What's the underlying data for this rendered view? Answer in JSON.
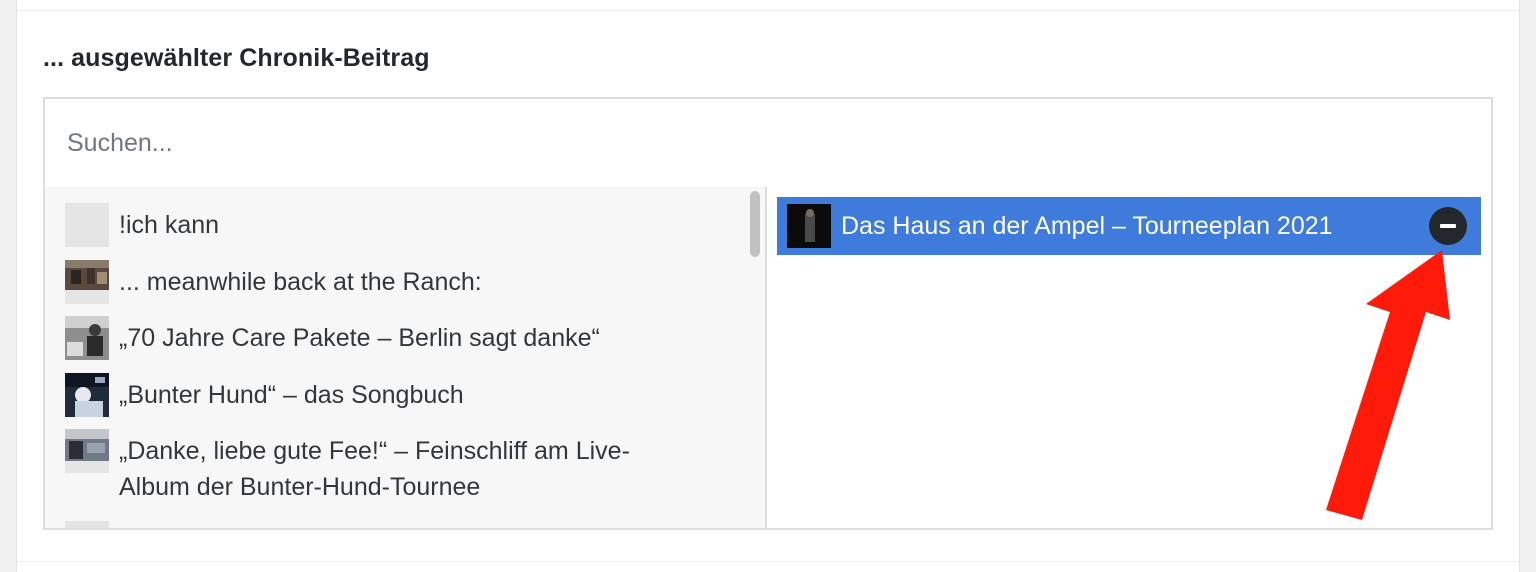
{
  "field": {
    "label": "... ausgewählter Chronik-Beitrag",
    "search_placeholder": "Suchen..."
  },
  "choices": [
    {
      "label": "!ich kann",
      "thumb": "blank"
    },
    {
      "label": "... meanwhile back at the Ranch:",
      "thumb": "photo"
    },
    {
      "label": "„70 Jahre Care Pakete – Berlin sagt danke“",
      "thumb": "photo"
    },
    {
      "label": "„Bunter Hund“ – das Songbuch",
      "thumb": "photo"
    },
    {
      "label": "„Danke, liebe gute Fee!“ – Feinschliff am Live-",
      "thumb": "photo"
    },
    {
      "label": "Album der Bunter-Hund-Tournee",
      "thumb": "none"
    }
  ],
  "selected": {
    "label": "Das Haus an der Ampel – Tourneeplan 2021",
    "remove_icon": "minus-icon"
  },
  "colors": {
    "selected_bg": "#3f7bdb",
    "arrow": "#ff1a0a"
  }
}
